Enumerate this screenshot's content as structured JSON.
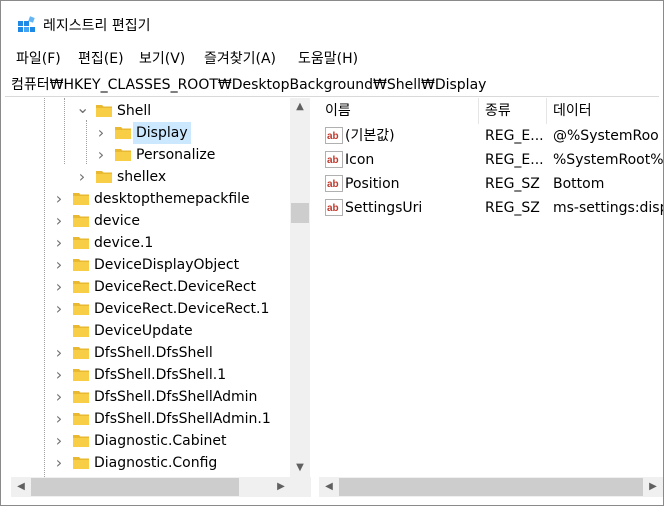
{
  "window": {
    "title": "레지스트리 편집기"
  },
  "menu": [
    "파일(F)",
    "편집(E)",
    "보기(V)",
    "즐겨찾기(A)",
    "도움말(H)"
  ],
  "address": "컴퓨터₩HKEY_CLASSES_ROOT₩DesktopBackground₩Shell₩Display",
  "tree": [
    {
      "label": "Shell",
      "state": "expanded"
    },
    {
      "label": "Display",
      "state": "collapsed",
      "selected": true
    },
    {
      "label": "Personalize",
      "state": "collapsed"
    },
    {
      "label": "shellex",
      "state": "collapsed"
    },
    {
      "label": "desktopthemepackfile",
      "state": "collapsed"
    },
    {
      "label": "device",
      "state": "collapsed"
    },
    {
      "label": "device.1",
      "state": "collapsed"
    },
    {
      "label": "DeviceDisplayObject",
      "state": "collapsed"
    },
    {
      "label": "DeviceRect.DeviceRect",
      "state": "collapsed"
    },
    {
      "label": "DeviceRect.DeviceRect.1",
      "state": "collapsed"
    },
    {
      "label": "DeviceUpdate",
      "state": "leaf"
    },
    {
      "label": "DfsShell.DfsShell",
      "state": "collapsed"
    },
    {
      "label": "DfsShell.DfsShell.1",
      "state": "collapsed"
    },
    {
      "label": "DfsShell.DfsShellAdmin",
      "state": "collapsed"
    },
    {
      "label": "DfsShell.DfsShellAdmin.1",
      "state": "collapsed"
    },
    {
      "label": "Diagnostic.Cabinet",
      "state": "collapsed"
    },
    {
      "label": "Diagnostic.Config",
      "state": "collapsed"
    }
  ],
  "list": {
    "columns": [
      "이름",
      "종류",
      "데이터"
    ],
    "rows": [
      {
        "name": "(기본값)",
        "type": "REG_E...",
        "data": "@%SystemRoo"
      },
      {
        "name": "Icon",
        "type": "REG_E...",
        "data": "%SystemRoot%"
      },
      {
        "name": "Position",
        "type": "REG_SZ",
        "data": "Bottom"
      },
      {
        "name": "SettingsUri",
        "type": "REG_SZ",
        "data": "ms-settings:disp"
      }
    ]
  },
  "icons": {
    "app": "registry-editor-icon",
    "folder": "folder-icon",
    "value": "string-value-icon"
  },
  "colors": {
    "selection": "#cce8ff",
    "folder": "#e8b931",
    "value_icon": "#c0392b"
  }
}
